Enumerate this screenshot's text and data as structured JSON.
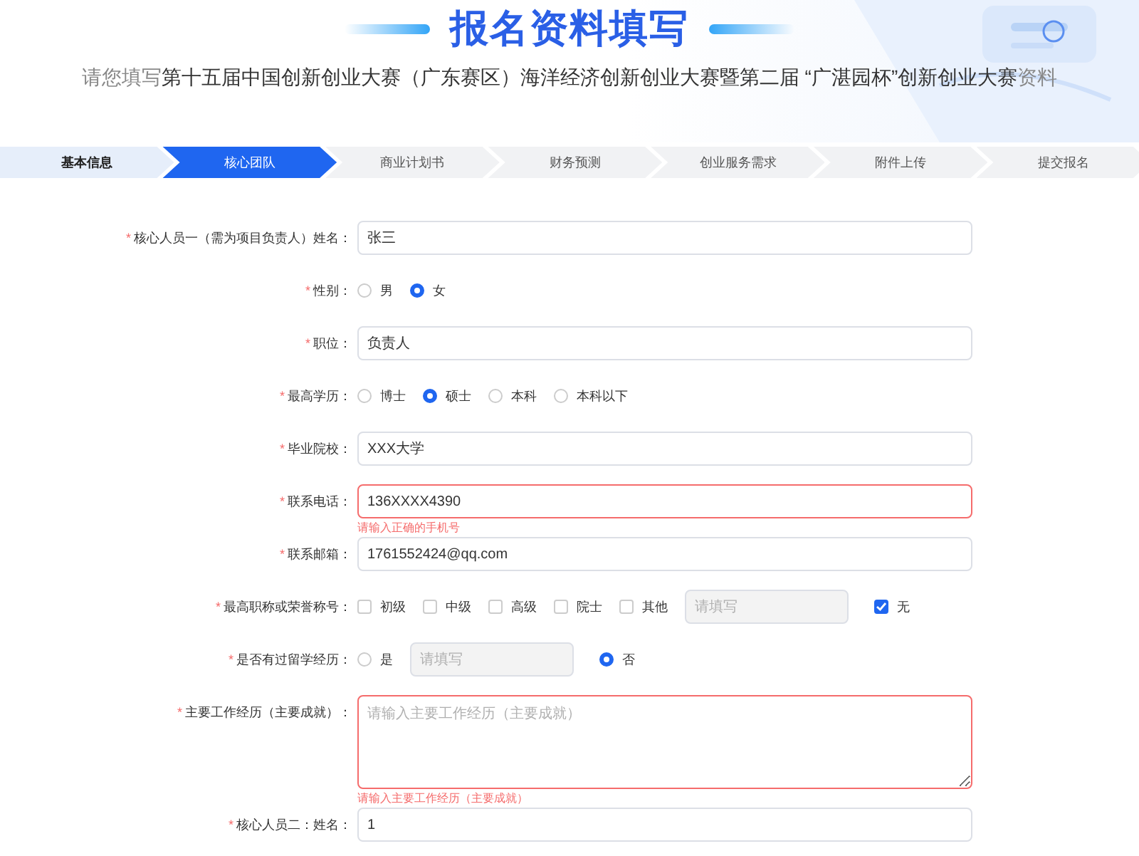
{
  "header": {
    "title": "报名资料填写",
    "subtitle": {
      "prefix": "请您填写",
      "highlight": "第十五届中国创新创业大赛（广东赛区）海洋经济创新创业大赛暨第二届 “广湛园杯”创新创业大赛",
      "suffix": "资料"
    }
  },
  "steps": [
    {
      "label": "基本信息",
      "done": true,
      "selected": false
    },
    {
      "label": "核心团队",
      "done": false,
      "selected": true
    },
    {
      "label": "商业计划书",
      "done": false,
      "selected": false
    },
    {
      "label": "财务预测",
      "done": false,
      "selected": false
    },
    {
      "label": "创业服务需求",
      "done": false,
      "selected": false
    },
    {
      "label": "附件上传",
      "done": false,
      "selected": false
    },
    {
      "label": "提交报名",
      "done": false,
      "selected": false
    }
  ],
  "required_mark": "*",
  "fields": [
    {
      "kind": "text",
      "label": "核心人员一（需为项目负责人）姓名：",
      "required": true,
      "value": "张三",
      "error": false
    },
    {
      "kind": "radio",
      "label": "性别：",
      "required": true,
      "options": [
        {
          "label": "男",
          "selected": false
        },
        {
          "label": "女",
          "selected": true
        }
      ]
    },
    {
      "kind": "text",
      "label": "职位：",
      "required": true,
      "value": "负责人",
      "error": false
    },
    {
      "kind": "radio",
      "label": "最高学历：",
      "required": true,
      "options": [
        {
          "label": "博士",
          "selected": false
        },
        {
          "label": "硕士",
          "selected": true
        },
        {
          "label": "本科",
          "selected": false
        },
        {
          "label": "本科以下",
          "selected": false
        }
      ]
    },
    {
      "kind": "text",
      "label": "毕业院校：",
      "required": true,
      "value": "XXX大学",
      "error": false
    },
    {
      "kind": "text",
      "label": "联系电话：",
      "required": true,
      "value": "136XXXX4390",
      "error": true,
      "error_text": "请输入正确的手机号"
    },
    {
      "kind": "text",
      "label": "联系邮箱：",
      "required": true,
      "value": "1761552424@qq.com",
      "error": false
    },
    {
      "kind": "checkbox",
      "label": "最高职称或荣誉称号：",
      "required": true,
      "options": [
        {
          "label": "初级",
          "checked": false
        },
        {
          "label": "中级",
          "checked": false
        },
        {
          "label": "高级",
          "checked": false
        },
        {
          "label": "院士",
          "checked": false
        },
        {
          "label": "其他",
          "checked": false
        },
        {
          "kind": "input",
          "placeholder": "请填写",
          "disabled": true
        },
        {
          "label": "无",
          "checked": true
        }
      ]
    },
    {
      "kind": "radio",
      "label": "是否有过留学经历：",
      "required": true,
      "options": [
        {
          "label": "是",
          "selected": false
        },
        {
          "kind": "input",
          "placeholder": "请填写",
          "disabled": true
        },
        {
          "label": "否",
          "selected": true
        }
      ]
    },
    {
      "kind": "textarea",
      "label": "主要工作经历（主要成就）：",
      "required": true,
      "placeholder": "请输入主要工作经历（主要成就）",
      "error": true,
      "error_text": "请输入主要工作经历（主要成就）"
    },
    {
      "kind": "text",
      "label": "核心人员二：姓名：",
      "required": true,
      "value": "1",
      "error": false
    }
  ]
}
